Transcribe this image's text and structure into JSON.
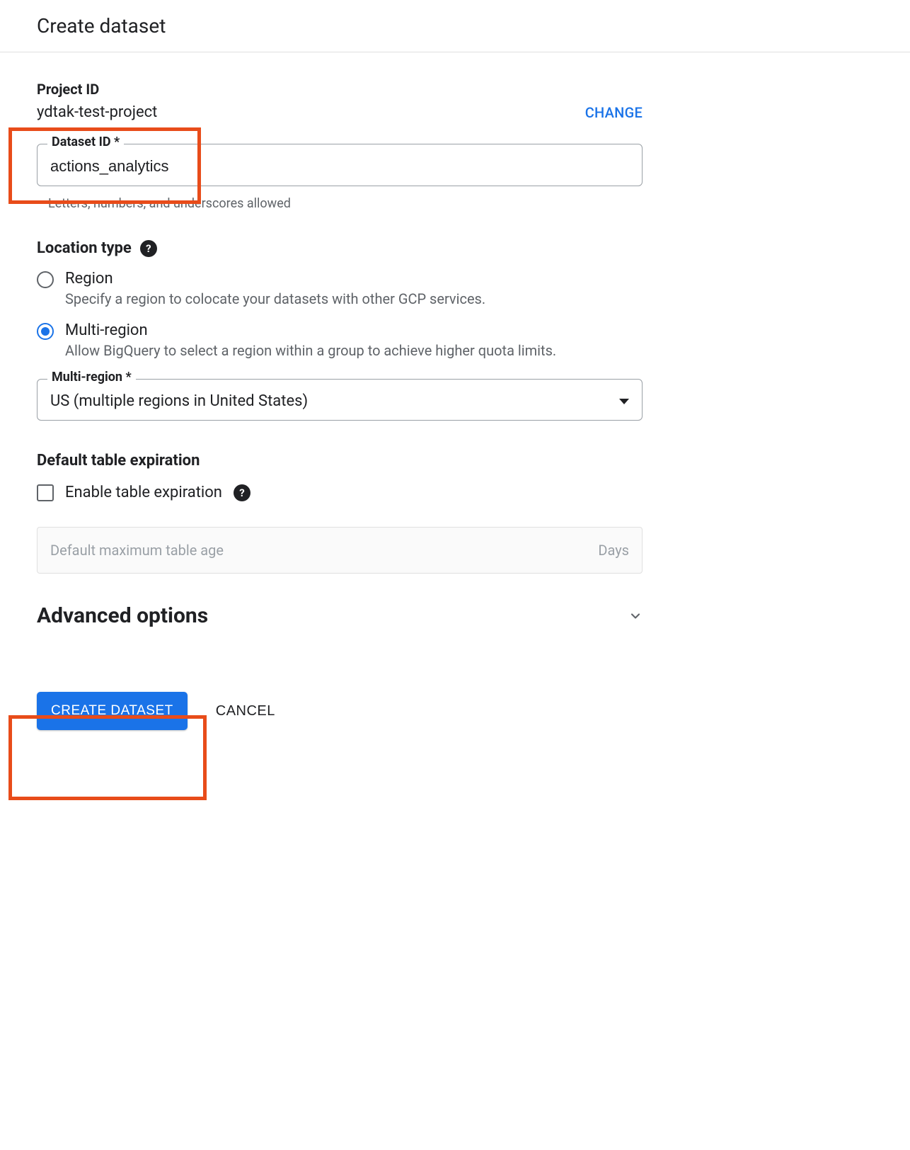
{
  "page_title": "Create dataset",
  "project": {
    "label": "Project ID",
    "value": "ydtak-test-project",
    "change_label": "CHANGE"
  },
  "dataset_id": {
    "label": "Dataset ID *",
    "value": "actions_analytics",
    "helper": "Letters, numbers, and underscores allowed"
  },
  "location": {
    "heading": "Location type",
    "options": [
      {
        "title": "Region",
        "desc": "Specify a region to colocate your datasets with other GCP services.",
        "selected": false
      },
      {
        "title": "Multi-region",
        "desc": "Allow BigQuery to select a region within a group to achieve higher quota limits.",
        "selected": true
      }
    ],
    "multi_region": {
      "label": "Multi-region *",
      "value": "US (multiple regions in United States)"
    }
  },
  "expiration": {
    "heading": "Default table expiration",
    "checkbox_label": "Enable table expiration",
    "checked": false,
    "max_age_placeholder": "Default maximum table age",
    "unit": "Days"
  },
  "advanced": {
    "title": "Advanced options"
  },
  "actions": {
    "create_label": "CREATE DATASET",
    "cancel_label": "CANCEL"
  }
}
